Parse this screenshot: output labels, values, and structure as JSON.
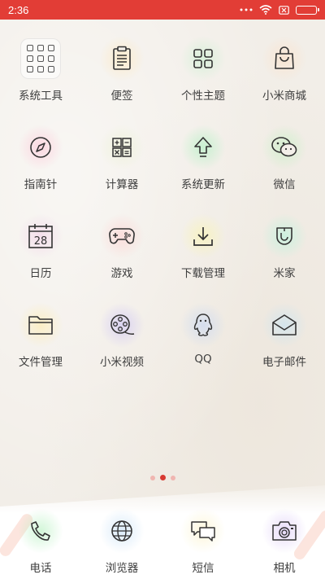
{
  "status": {
    "time": "2:36",
    "battery_color": "#58d048"
  },
  "apps": [
    {
      "label": "系统工具",
      "icon": "folder-icon"
    },
    {
      "label": "便签",
      "icon": "notes-icon"
    },
    {
      "label": "个性主题",
      "icon": "themes-icon"
    },
    {
      "label": "小米商城",
      "icon": "shopping-bag-icon"
    },
    {
      "label": "指南针",
      "icon": "compass-icon"
    },
    {
      "label": "计算器",
      "icon": "calculator-icon"
    },
    {
      "label": "系统更新",
      "icon": "update-arrow-icon"
    },
    {
      "label": "微信",
      "icon": "wechat-icon"
    },
    {
      "label": "日历",
      "icon": "calendar-icon"
    },
    {
      "label": "游戏",
      "icon": "gamepad-icon"
    },
    {
      "label": "下载管理",
      "icon": "download-icon"
    },
    {
      "label": "米家",
      "icon": "mijia-icon"
    },
    {
      "label": "文件管理",
      "icon": "file-folder-icon"
    },
    {
      "label": "小米视频",
      "icon": "film-reel-icon"
    },
    {
      "label": "QQ",
      "icon": "qq-penguin-icon"
    },
    {
      "label": "电子邮件",
      "icon": "envelope-icon"
    }
  ],
  "calendar_day": "28",
  "dock": [
    {
      "label": "电话",
      "icon": "phone-icon"
    },
    {
      "label": "浏览器",
      "icon": "globe-icon"
    },
    {
      "label": "短信",
      "icon": "message-icon"
    },
    {
      "label": "相机",
      "icon": "camera-icon"
    }
  ],
  "page_indicator": {
    "count": 3,
    "active": 1,
    "active_color": "#d83a32"
  }
}
